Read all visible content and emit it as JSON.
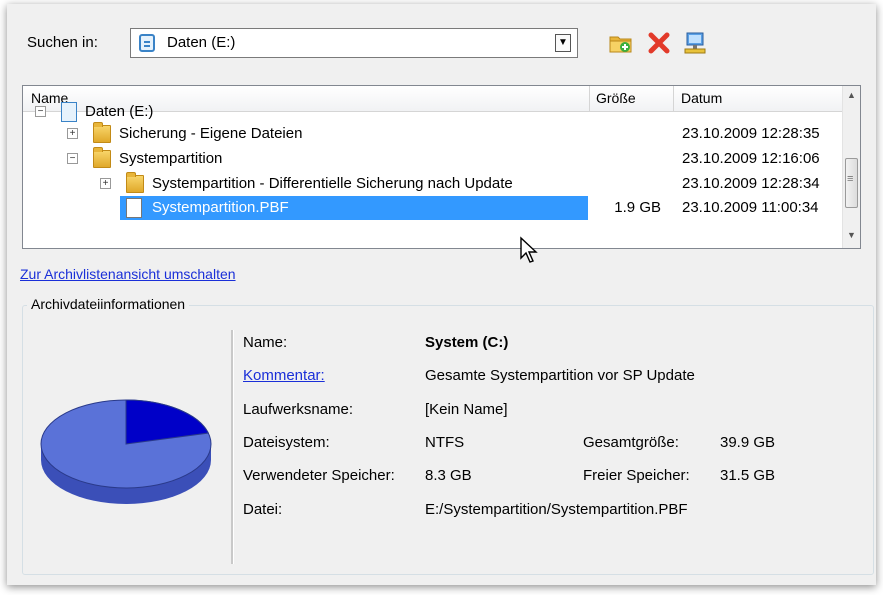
{
  "toolbar": {
    "lookin_label": "Suchen in:",
    "lookin_value": "Daten (E:)",
    "icons": [
      "new-folder-icon",
      "delete-icon",
      "network-icon"
    ]
  },
  "tree": {
    "columns": [
      "Name",
      "Größe",
      "Datum"
    ],
    "rows": [
      {
        "name": "Daten (E:)",
        "size": "",
        "date": ""
      },
      {
        "name": "Sicherung - Eigene Dateien",
        "size": "",
        "date": "23.10.2009 12:28:35"
      },
      {
        "name": "Systempartition",
        "size": "",
        "date": "23.10.2009 12:16:06"
      },
      {
        "name": "Systempartition - Differentielle Sicherung nach Update",
        "size": "",
        "date": "23.10.2009 12:28:34"
      },
      {
        "name": "Systempartition.PBF",
        "size": "1.9 GB",
        "date": "23.10.2009 11:00:34"
      }
    ]
  },
  "switch_link": "Zur Archivlistenansicht umschalten",
  "info": {
    "legend": "Archivdateiinformationen",
    "name_label": "Name:",
    "name_value": "System (C:)",
    "comment_label": "Kommentar:",
    "comment_value": "Gesamte Systempartition vor SP Update",
    "drivename_label": "Laufwerksname:",
    "drivename_value": "[Kein Name]",
    "fs_label": "Dateisystem:",
    "fs_value": "NTFS",
    "total_label": "Gesamtgröße:",
    "total_value": "39.9 GB",
    "used_label": "Verwendeter Speicher:",
    "used_value": "8.3 GB",
    "free_label": "Freier Speicher:",
    "free_value": "31.5 GB",
    "file_label": "Datei:",
    "file_value": "E:/Systempartition/Systempartition.PBF",
    "pie_used_fraction": 0.21,
    "colors": {
      "free": "#5a72d8",
      "used": "#0000c8"
    }
  },
  "colors": {
    "selection": "#3399ff",
    "link": "#1a2fd8"
  }
}
